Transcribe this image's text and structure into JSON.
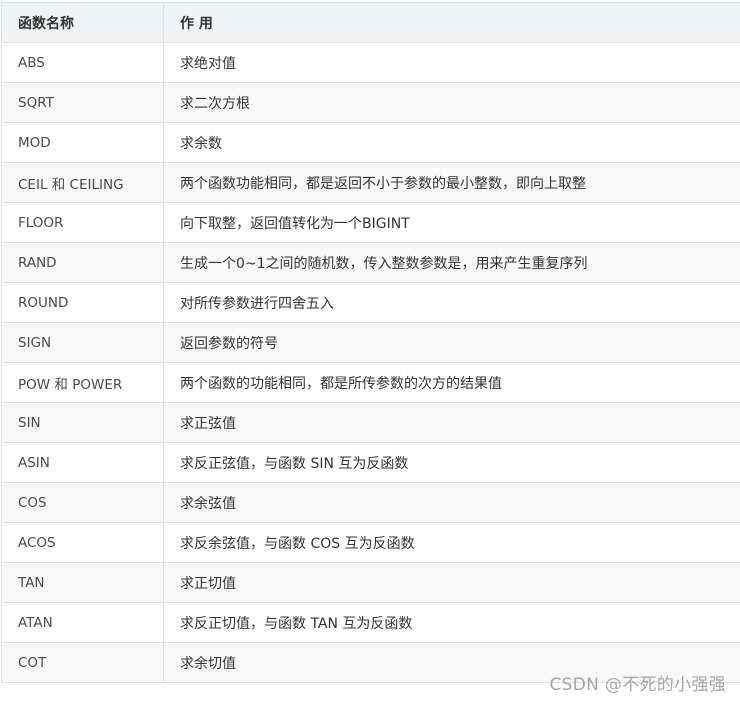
{
  "table": {
    "headers": [
      "函数名称",
      "作 用"
    ],
    "rows": [
      {
        "name": "ABS",
        "desc": "求绝对值"
      },
      {
        "name": "SQRT",
        "desc": "求二次方根"
      },
      {
        "name": "MOD",
        "desc": "求余数"
      },
      {
        "name": "CEIL 和 CEILING",
        "desc": "两个函数功能相同，都是返回不小于参数的最小整数，即向上取整"
      },
      {
        "name": "FLOOR",
        "desc": "向下取整，返回值转化为一个BIGINT"
      },
      {
        "name": "RAND",
        "desc": "生成一个0~1之间的随机数，传入整数参数是，用来产生重复序列"
      },
      {
        "name": "ROUND",
        "desc": "对所传参数进行四舍五入"
      },
      {
        "name": "SIGN",
        "desc": "返回参数的符号"
      },
      {
        "name": "POW 和 POWER",
        "desc": "两个函数的功能相同，都是所传参数的次方的结果值"
      },
      {
        "name": "SIN",
        "desc": "求正弦值"
      },
      {
        "name": "ASIN",
        "desc": "求反正弦值，与函数 SIN 互为反函数"
      },
      {
        "name": "COS",
        "desc": "求余弦值"
      },
      {
        "name": "ACOS",
        "desc": "求反余弦值，与函数 COS 互为反函数"
      },
      {
        "name": "TAN",
        "desc": "求正切值"
      },
      {
        "name": "ATAN",
        "desc": "求反正切值，与函数 TAN 互为反函数"
      },
      {
        "name": "COT",
        "desc": "求余切值"
      }
    ]
  },
  "watermark": "CSDN @不死的小强强",
  "colors": {
    "header_bg": "#eff3f5",
    "row_alt_bg": "#f8f8f8",
    "border": "#dfe2e5"
  }
}
